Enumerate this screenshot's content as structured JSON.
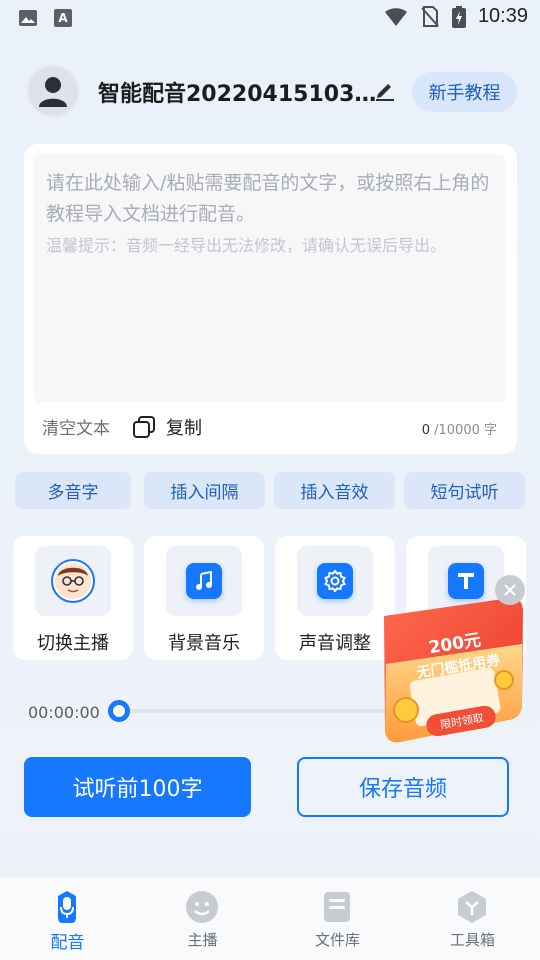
{
  "status_bar": {
    "time": "10:39"
  },
  "header": {
    "title": "智能配音20220415103…",
    "tutorial_label": "新手教程"
  },
  "editor": {
    "placeholder": "请在此处输入/粘贴需要配音的文字，或按照右上角的教程导入文档进行配音。",
    "tip": "温馨提示：音频一经导出无法修改，请确认无误后导出。",
    "clear_label": "清空文本",
    "copy_label": "复制",
    "char_count": "0",
    "char_limit": " /10000 字"
  },
  "chips": [
    "多音字",
    "插入间隔",
    "插入音效",
    "短句试听"
  ],
  "tools": [
    {
      "label": "切换主播",
      "icon": "anchor-avatar-icon"
    },
    {
      "label": "背景音乐",
      "icon": "music-note-icon"
    },
    {
      "label": "声音调整",
      "icon": "gear-icon"
    },
    {
      "label": "文字",
      "icon": "text-t-icon"
    }
  ],
  "player": {
    "current_time": "00:00:00",
    "progress": 0
  },
  "actions": {
    "preview_label": "试听前100字",
    "save_label": "保存音频"
  },
  "promo": {
    "amount": "200元",
    "subtitle": "无门槛抵用券",
    "cta": "限时领取"
  },
  "bottom_nav": [
    {
      "label": "配音",
      "icon": "mic-icon",
      "active": true
    },
    {
      "label": "主播",
      "icon": "smiley-icon",
      "active": false
    },
    {
      "label": "文件库",
      "icon": "folder-icon",
      "active": false
    },
    {
      "label": "工具箱",
      "icon": "toolbox-icon",
      "active": false
    }
  ],
  "colors": {
    "accent": "#1677ff",
    "chip_bg": "#dbe7f9",
    "promo_red": "#f04e36",
    "promo_orange": "#ff9a3c"
  }
}
